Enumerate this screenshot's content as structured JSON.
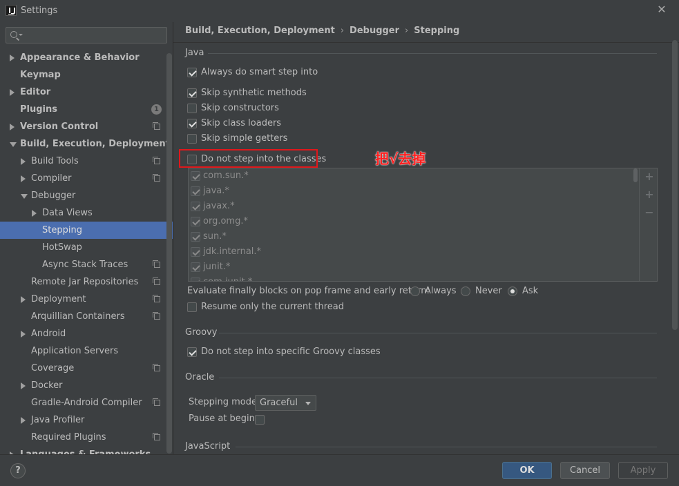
{
  "window": {
    "title": "Settings"
  },
  "sidebar": {
    "search_placeholder": "",
    "items": [
      {
        "label": "Appearance & Behavior",
        "level": 0,
        "arrow": "right",
        "bold": true
      },
      {
        "label": "Keymap",
        "level": 0,
        "arrow": "",
        "bold": true
      },
      {
        "label": "Editor",
        "level": 0,
        "arrow": "right",
        "bold": true
      },
      {
        "label": "Plugins",
        "level": 0,
        "arrow": "",
        "bold": true,
        "badge": "1"
      },
      {
        "label": "Version Control",
        "level": 0,
        "arrow": "right",
        "bold": true,
        "icon": "copy"
      },
      {
        "label": "Build, Execution, Deployment",
        "level": 0,
        "arrow": "down",
        "bold": true
      },
      {
        "label": "Build Tools",
        "level": 1,
        "arrow": "right",
        "icon": "copy"
      },
      {
        "label": "Compiler",
        "level": 1,
        "arrow": "right",
        "icon": "copy"
      },
      {
        "label": "Debugger",
        "level": 1,
        "arrow": "down"
      },
      {
        "label": "Data Views",
        "level": 2,
        "arrow": "right"
      },
      {
        "label": "Stepping",
        "level": 2,
        "arrow": "",
        "selected": true
      },
      {
        "label": "HotSwap",
        "level": 2,
        "arrow": ""
      },
      {
        "label": "Async Stack Traces",
        "level": 2,
        "arrow": "",
        "icon": "copy"
      },
      {
        "label": "Remote Jar Repositories",
        "level": 1,
        "arrow": "",
        "icon": "copy"
      },
      {
        "label": "Deployment",
        "level": 1,
        "arrow": "right",
        "icon": "copy"
      },
      {
        "label": "Arquillian Containers",
        "level": 1,
        "arrow": "",
        "icon": "copy"
      },
      {
        "label": "Android",
        "level": 1,
        "arrow": "right"
      },
      {
        "label": "Application Servers",
        "level": 1,
        "arrow": ""
      },
      {
        "label": "Coverage",
        "level": 1,
        "arrow": "",
        "icon": "copy"
      },
      {
        "label": "Docker",
        "level": 1,
        "arrow": "right"
      },
      {
        "label": "Gradle-Android Compiler",
        "level": 1,
        "arrow": "",
        "icon": "copy"
      },
      {
        "label": "Java Profiler",
        "level": 1,
        "arrow": "right"
      },
      {
        "label": "Required Plugins",
        "level": 1,
        "arrow": "",
        "icon": "copy"
      },
      {
        "label": "Languages & Frameworks",
        "level": 0,
        "arrow": "right",
        "bold": true
      }
    ]
  },
  "breadcrumb": [
    "Build, Execution, Deployment",
    "Debugger",
    "Stepping"
  ],
  "breadcrumb_sep": "›",
  "java": {
    "title": "Java",
    "options": [
      {
        "label": "Always do smart step into",
        "checked": true
      },
      {
        "label": "Skip synthetic methods",
        "checked": true
      },
      {
        "label": "Skip constructors",
        "checked": false
      },
      {
        "label": "Skip class loaders",
        "checked": true
      },
      {
        "label": "Skip simple getters",
        "checked": false
      },
      {
        "label": "Do not step into the classes",
        "checked": false
      }
    ],
    "classes": [
      "com.sun.*",
      "java.*",
      "javax.*",
      "org.omg.*",
      "sun.*",
      "jdk.internal.*",
      "junit.*",
      "com.junit.*"
    ],
    "evaluate_label": "Evaluate finally blocks on pop frame and early return:",
    "radios": [
      {
        "label": "Always",
        "selected": false
      },
      {
        "label": "Never",
        "selected": false
      },
      {
        "label": "Ask",
        "selected": true
      }
    ],
    "resume_label": "Resume only the current thread",
    "resume_checked": false
  },
  "annotation": "把√去掉",
  "groovy": {
    "title": "Groovy",
    "option_label": "Do not step into specific Groovy classes",
    "checked": true
  },
  "oracle": {
    "title": "Oracle",
    "stepping_mode_label": "Stepping mode:",
    "stepping_mode_value": "Graceful",
    "pause_label": "Pause at begin:",
    "pause_checked": false
  },
  "javascript": {
    "title": "JavaScript"
  },
  "buttons": {
    "help": "?",
    "ok": "OK",
    "cancel": "Cancel",
    "apply": "Apply"
  },
  "colors": {
    "accent": "#4b6eaf",
    "ok_button": "#365880",
    "annotation": "#ff2020",
    "highlight_box": "#e0171b"
  }
}
